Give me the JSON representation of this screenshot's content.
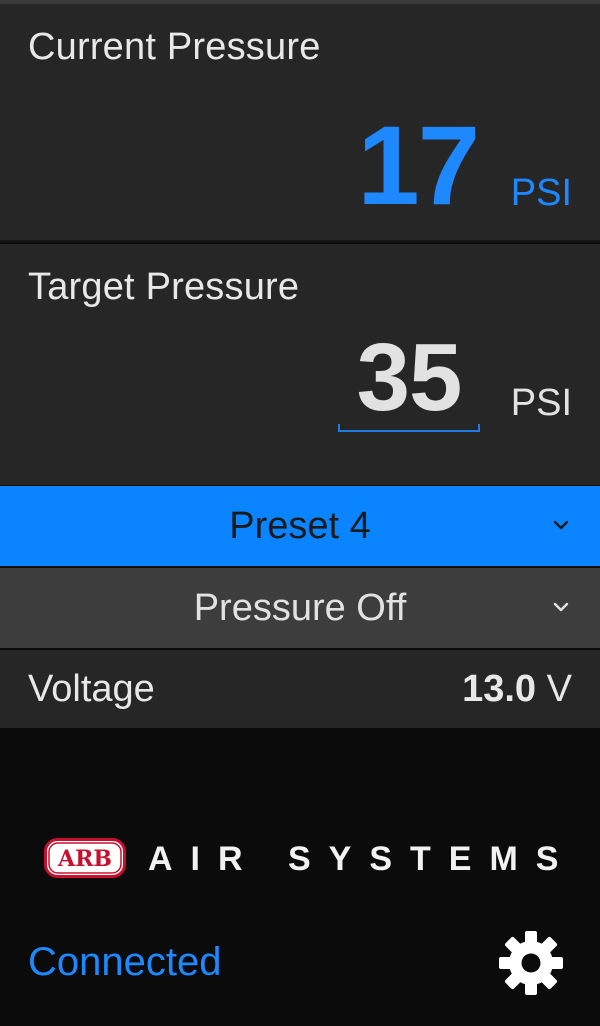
{
  "current": {
    "label": "Current Pressure",
    "value": "17",
    "unit": "PSI"
  },
  "target": {
    "label": "Target Pressure",
    "value": "35",
    "unit": "PSI"
  },
  "preset_dropdown": {
    "selected": "Preset 4"
  },
  "mode_dropdown": {
    "selected": "Pressure Off"
  },
  "voltage": {
    "label": "Voltage",
    "value": "13.0",
    "unit": "V"
  },
  "branding": {
    "logo_text": "ARB",
    "tagline": "AIR SYSTEMS"
  },
  "status": {
    "connection": "Connected"
  },
  "icons": {
    "dropdown": "chevron-down-icon",
    "settings": "gear-icon"
  },
  "colors": {
    "accent": "#0a84ff",
    "value_blue": "#1e88ff",
    "panel": "#262626",
    "background": "#0b0b0b"
  }
}
